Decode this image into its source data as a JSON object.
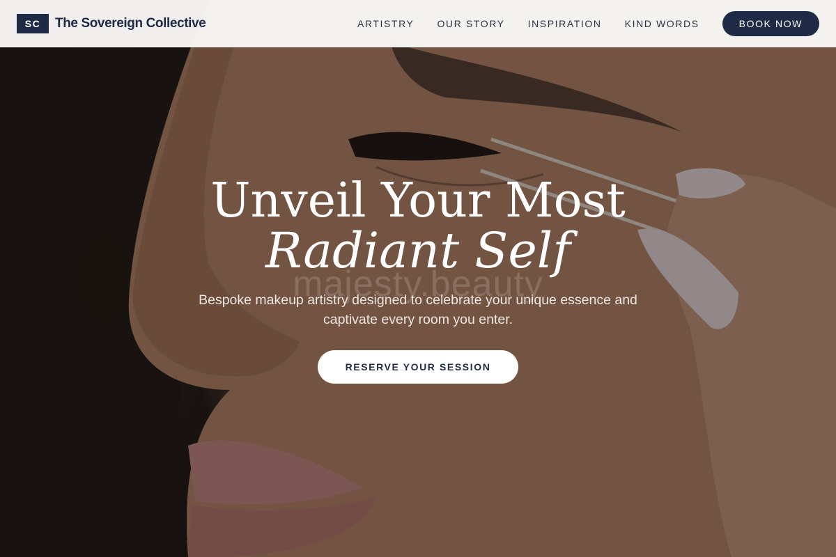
{
  "brand": {
    "badge": "SC",
    "name": "The Sovereign Collective"
  },
  "nav": {
    "links": [
      {
        "label": "ARTISTRY"
      },
      {
        "label": "OUR STORY"
      },
      {
        "label": "INSPIRATION"
      },
      {
        "label": "KIND WORDS"
      }
    ],
    "book_label": "BOOK NOW"
  },
  "hero": {
    "title_line1": "Unveil Your Most",
    "title_line2": "Radiant Self",
    "watermark": "majesty.beauty",
    "subtitle": "Bespoke makeup artistry designed to celebrate your unique essence and captivate every room you enter.",
    "cta_label": "RESERVE YOUR SESSION",
    "image_subject": "close-up-makeup-application-photo"
  },
  "colors": {
    "navy": "#1f2a44",
    "nav_background": "#faf9f7",
    "white": "#ffffff"
  }
}
